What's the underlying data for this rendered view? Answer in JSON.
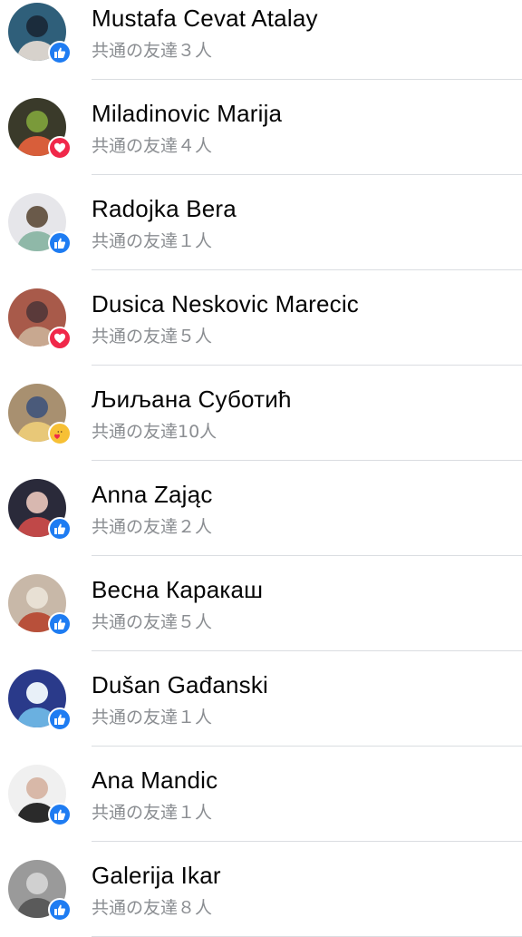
{
  "friends": [
    {
      "name": "Mustafa Cevat Atalay",
      "mutual": "共通の友達３人",
      "reaction": "like-icon",
      "avatar_colors": [
        "#2f5f7a",
        "#d7d2cc",
        "#1b2c3c"
      ]
    },
    {
      "name": "Miladinovic Marija",
      "mutual": "共通の友達４人",
      "reaction": "love-icon",
      "avatar_colors": [
        "#3a3a2a",
        "#d85e3a",
        "#7a9a3a"
      ]
    },
    {
      "name": "Radojka Bera",
      "mutual": "共通の友達１人",
      "reaction": "like-icon",
      "avatar_colors": [
        "#e6e6ea",
        "#8fb8a8",
        "#6a5a4a"
      ]
    },
    {
      "name": "Dusica Neskovic Marecic",
      "mutual": "共通の友達５人",
      "reaction": "love-icon",
      "avatar_colors": [
        "#a85a4a",
        "#c8a890",
        "#5a3a3a"
      ]
    },
    {
      "name": "Љиљана Суботић",
      "mutual": "共通の友達10人",
      "reaction": "care-icon",
      "avatar_colors": [
        "#a89070",
        "#e8c878",
        "#4a5a7a"
      ]
    },
    {
      "name": "Anna Zając",
      "mutual": "共通の友達２人",
      "reaction": "like-icon",
      "avatar_colors": [
        "#2a2a3a",
        "#c04848",
        "#d8b8b0"
      ]
    },
    {
      "name": "Весна Каракаш",
      "mutual": "共通の友達５人",
      "reaction": "like-icon",
      "avatar_colors": [
        "#c8b8a8",
        "#b8503a",
        "#e8e0d4"
      ]
    },
    {
      "name": "Dušan Gađanski",
      "mutual": "共通の友達１人",
      "reaction": "like-icon",
      "avatar_colors": [
        "#2a3a8a",
        "#6ab0e0",
        "#e8f0f8"
      ]
    },
    {
      "name": "Ana Mandic",
      "mutual": "共通の友達１人",
      "reaction": "like-icon",
      "avatar_colors": [
        "#f0f0f0",
        "#2a2a2a",
        "#d8b8a8"
      ]
    },
    {
      "name": "Galerija Ikar",
      "mutual": "共通の友達８人",
      "reaction": "like-icon",
      "avatar_colors": [
        "#9a9a9a",
        "#5a5a5a",
        "#d0d0d0"
      ]
    }
  ]
}
